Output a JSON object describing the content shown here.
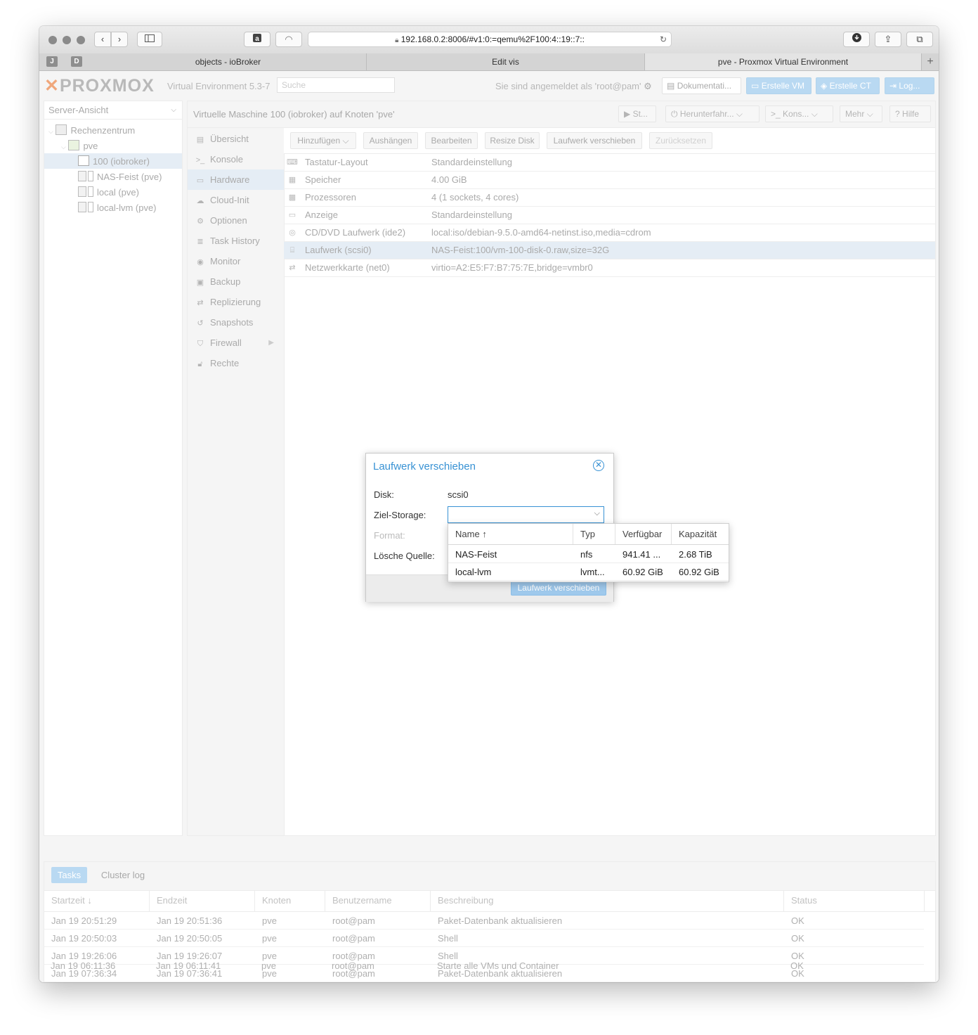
{
  "browser": {
    "address": "192.168.0.2:8006/#v1:0:=qemu%2F100:4::19::7::",
    "tab_letters": [
      "J",
      "D"
    ],
    "tabs": [
      "objects - ioBroker",
      "Edit vis",
      "pve - Proxmox Virtual Environment"
    ],
    "new_tab": "+"
  },
  "header": {
    "logo": "PROXMOX",
    "version": "Virtual Environment 5.3-7",
    "search_placeholder": "Suche",
    "login_text": "Sie sind angemeldet als 'root@pam'",
    "btn_docs": "Dokumentati...",
    "btn_create_vm": "Erstelle VM",
    "btn_create_ct": "Erstelle CT",
    "btn_logout": "Log..."
  },
  "tree": {
    "view": "Server-Ansicht",
    "items": [
      "Rechenzentrum",
      "pve",
      "100 (iobroker)",
      "NAS-Feist (pve)",
      "local (pve)",
      "local-lvm (pve)"
    ]
  },
  "content": {
    "title": "Virtuelle Maschine 100 (iobroker) auf Knoten 'pve'",
    "actions": [
      "St...",
      "Herunterfahr...",
      "Kons...",
      "Mehr",
      "Hilfe"
    ]
  },
  "nav": [
    "Übersicht",
    "Konsole",
    "Hardware",
    "Cloud-Init",
    "Optionen",
    "Task History",
    "Monitor",
    "Backup",
    "Replizierung",
    "Snapshots",
    "Firewall",
    "Rechte"
  ],
  "hw_toolbar": [
    "Hinzufügen",
    "Aushängen",
    "Bearbeiten",
    "Resize Disk",
    "Laufwerk verschieben",
    "Zurücksetzen"
  ],
  "hardware": [
    {
      "key": "Tastatur-Layout",
      "value": "Standardeinstellung"
    },
    {
      "key": "Speicher",
      "value": "4.00 GiB"
    },
    {
      "key": "Prozessoren",
      "value": "4 (1 sockets, 4 cores)"
    },
    {
      "key": "Anzeige",
      "value": "Standardeinstellung"
    },
    {
      "key": "CD/DVD Laufwerk (ide2)",
      "value": "local:iso/debian-9.5.0-amd64-netinst.iso,media=cdrom"
    },
    {
      "key": "Laufwerk (scsi0)",
      "value": "NAS-Feist:100/vm-100-disk-0.raw,size=32G"
    },
    {
      "key": "Netzwerkkarte (net0)",
      "value": "virtio=A2:E5:F7:B7:75:7E,bridge=vmbr0"
    }
  ],
  "dialog": {
    "title": "Laufwerk verschieben",
    "disk_label": "Disk:",
    "disk_value": "scsi0",
    "target_label": "Ziel-Storage:",
    "format_label": "Format:",
    "delete_label": "Lösche Quelle:",
    "submit": "Laufwerk verschieben"
  },
  "picker": {
    "columns": [
      "Name",
      "Typ",
      "Verfügbar",
      "Kapazität"
    ],
    "sort_indicator": "↑",
    "rows": [
      {
        "name": "NAS-Feist",
        "type": "nfs",
        "avail": "941.41 ...",
        "cap": "2.68 TiB"
      },
      {
        "name": "local-lvm",
        "type": "lvmt...",
        "avail": "60.92 GiB",
        "cap": "60.92 GiB"
      }
    ]
  },
  "tasks": {
    "tabs": [
      "Tasks",
      "Cluster log"
    ],
    "columns": [
      "Startzeit",
      "Endzeit",
      "Knoten",
      "Benutzername",
      "Beschreibung",
      "Status"
    ],
    "sort_indicator": "↓",
    "rows": [
      [
        "Jan 19 20:51:29",
        "Jan 19 20:51:36",
        "pve",
        "root@pam",
        "Paket-Datenbank aktualisieren",
        "OK"
      ],
      [
        "Jan 19 20:50:03",
        "Jan 19 20:50:05",
        "pve",
        "root@pam",
        "Shell",
        "OK"
      ],
      [
        "Jan 19 19:26:06",
        "Jan 19 19:26:07",
        "pve",
        "root@pam",
        "Shell",
        "OK"
      ],
      [
        "Jan 19 07:36:34",
        "Jan 19 07:36:41",
        "pve",
        "root@pam",
        "Paket-Datenbank aktualisieren",
        "OK"
      ],
      [
        "Jan 19 06:11:36",
        "Jan 19 06:11:41",
        "pve",
        "root@pam",
        "Starte alle VMs und Container",
        "OK"
      ]
    ]
  },
  "colors": {
    "accent": "#3892d4",
    "selection": "#e5edf5",
    "logo_x": "#f0a77b"
  }
}
